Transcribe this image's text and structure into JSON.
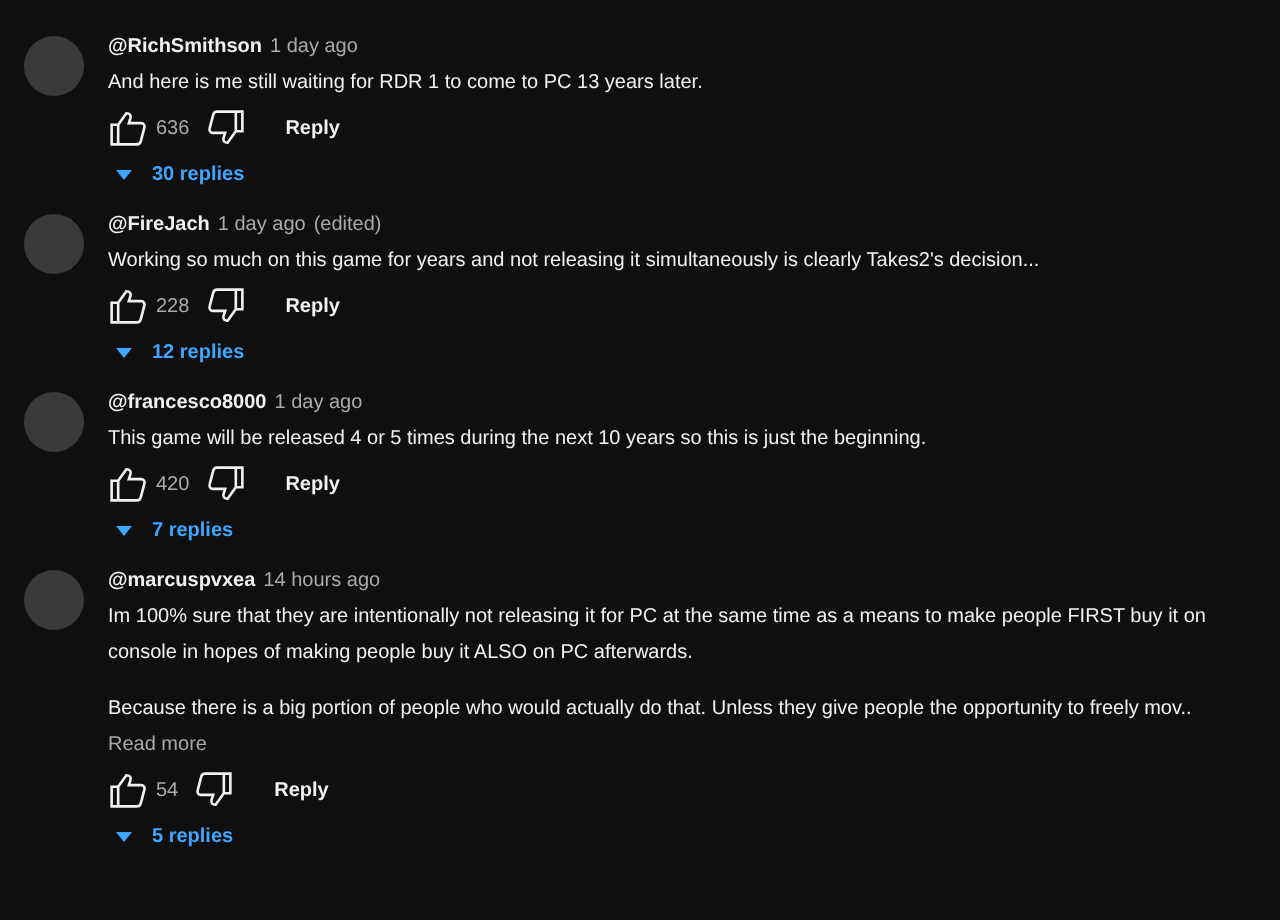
{
  "comments": [
    {
      "author": "@RichSmithson",
      "time": "1 day ago",
      "paragraphs": [
        "And here is me still waiting for RDR 1 to come to PC 13 years later."
      ],
      "likes": "636",
      "reply": "Reply",
      "replies": "30 replies"
    },
    {
      "author": "@FireJach",
      "time": "1 day ago",
      "edited": "(edited)",
      "paragraphs": [
        "Working so much on this game for years and not releasing it simultaneously is clearly Takes2's decision..."
      ],
      "likes": "228",
      "reply": "Reply",
      "replies": "12 replies"
    },
    {
      "author": "@francesco8000",
      "time": "1 day ago",
      "paragraphs": [
        "This game will be released 4 or 5 times during the next 10 years so this is just the beginning."
      ],
      "likes": "420",
      "reply": "Reply",
      "replies": "7 replies"
    },
    {
      "author": "@marcuspvxea",
      "time": "14 hours ago",
      "paragraphs": [
        "Im 100% sure that they are intentionally not releasing it for PC at the same time as a means to make people FIRST buy it on console in hopes of making people buy it ALSO on PC afterwards.",
        "Because there is a big portion of people who would actually do that. Unless they give people the opportunity to freely mov.."
      ],
      "read_more": "Read more",
      "likes": "54",
      "reply": "Reply",
      "replies": "5 replies"
    }
  ]
}
